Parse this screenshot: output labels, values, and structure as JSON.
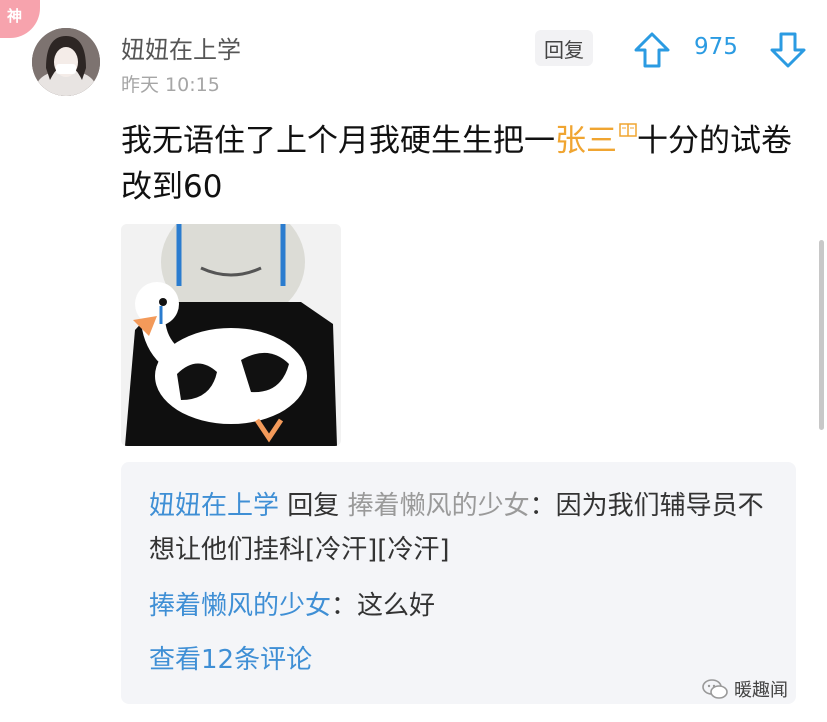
{
  "badge": {
    "label": "神"
  },
  "post": {
    "username": "妞妞在上学",
    "time": "昨天 10:15",
    "reply_label": "回复",
    "vote_count": "975",
    "comment_prefix": "我无语住了上个月我硬生生把一",
    "comment_tag": "张三",
    "comment_suffix": "十分的试卷改到60"
  },
  "replies": {
    "line1": {
      "author": "妞妞在上学",
      "action": "回复",
      "target": "捧着懒风的少女",
      "text": "：因为我们辅导员不想让他们挂科[冷汗][冷汗]"
    },
    "line2": {
      "author": "捧着懒风的少女",
      "text": "：这么好"
    },
    "more_label": "查看12条评论"
  },
  "watermark": {
    "label": "暖趣闻"
  },
  "colors": {
    "accent_blue": "#2b9be2",
    "tag_orange": "#f0a531",
    "badge_pink": "#f7a3ad"
  },
  "icons": [
    "upvote-arrow-icon",
    "downvote-arrow-icon",
    "book-icon",
    "wechat-icon"
  ]
}
